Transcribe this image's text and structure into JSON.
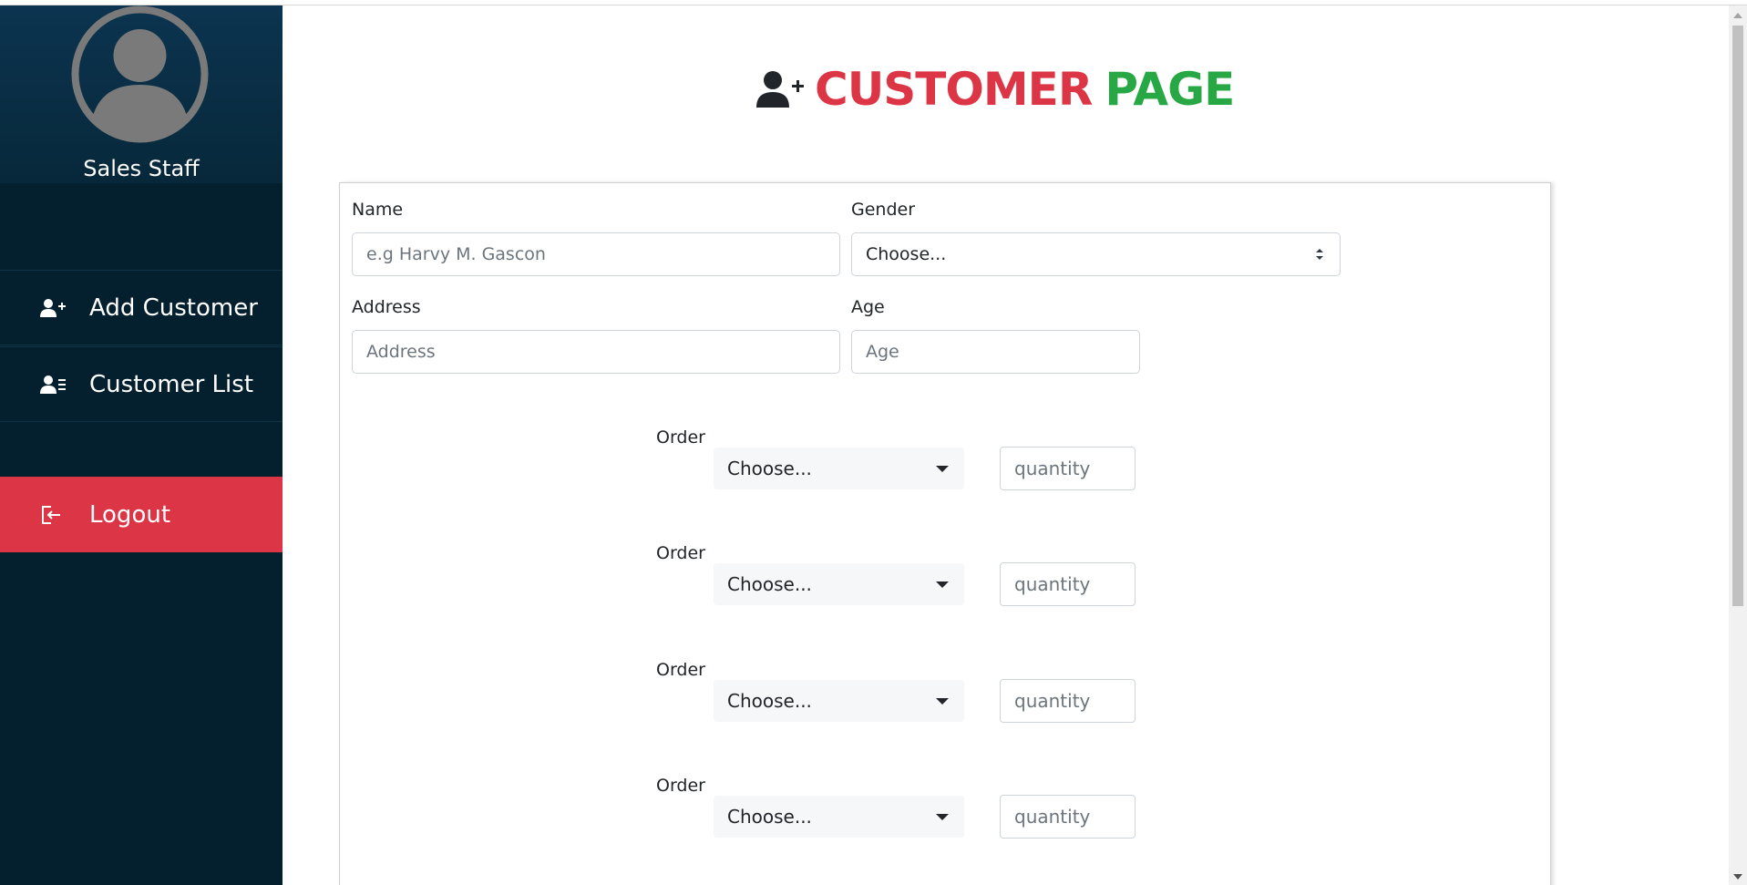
{
  "sidebar": {
    "profile_name": "Sales Staff",
    "items": [
      {
        "label": "Add Customer",
        "icon": "user-plus-icon"
      },
      {
        "label": "Customer List",
        "icon": "user-list-icon"
      },
      {
        "label": "Logout",
        "icon": "logout-icon"
      }
    ]
  },
  "header": {
    "title_part1": "CUSTOMER",
    "title_part2": "PAGE",
    "icon": "user-plus-icon"
  },
  "form": {
    "name_label": "Name",
    "name_placeholder": "e.g Harvy M. Gascon",
    "gender_label": "Gender",
    "gender_value": "Choose...",
    "address_label": "Address",
    "address_placeholder": "Address",
    "age_label": "Age",
    "age_placeholder": "Age",
    "orders": [
      {
        "label": "Order",
        "select_value": "Choose...",
        "qty_placeholder": "quantity"
      },
      {
        "label": "Order",
        "select_value": "Choose...",
        "qty_placeholder": "quantity"
      },
      {
        "label": "Order",
        "select_value": "Choose...",
        "qty_placeholder": "quantity"
      },
      {
        "label": "Order",
        "select_value": "Choose...",
        "qty_placeholder": "quantity"
      }
    ]
  },
  "colors": {
    "sidebar_bg": "#04202e",
    "profile_bg": "#0c3450",
    "logout_bg": "#dc3545",
    "title_red": "#dc3545",
    "title_green": "#28a745"
  }
}
